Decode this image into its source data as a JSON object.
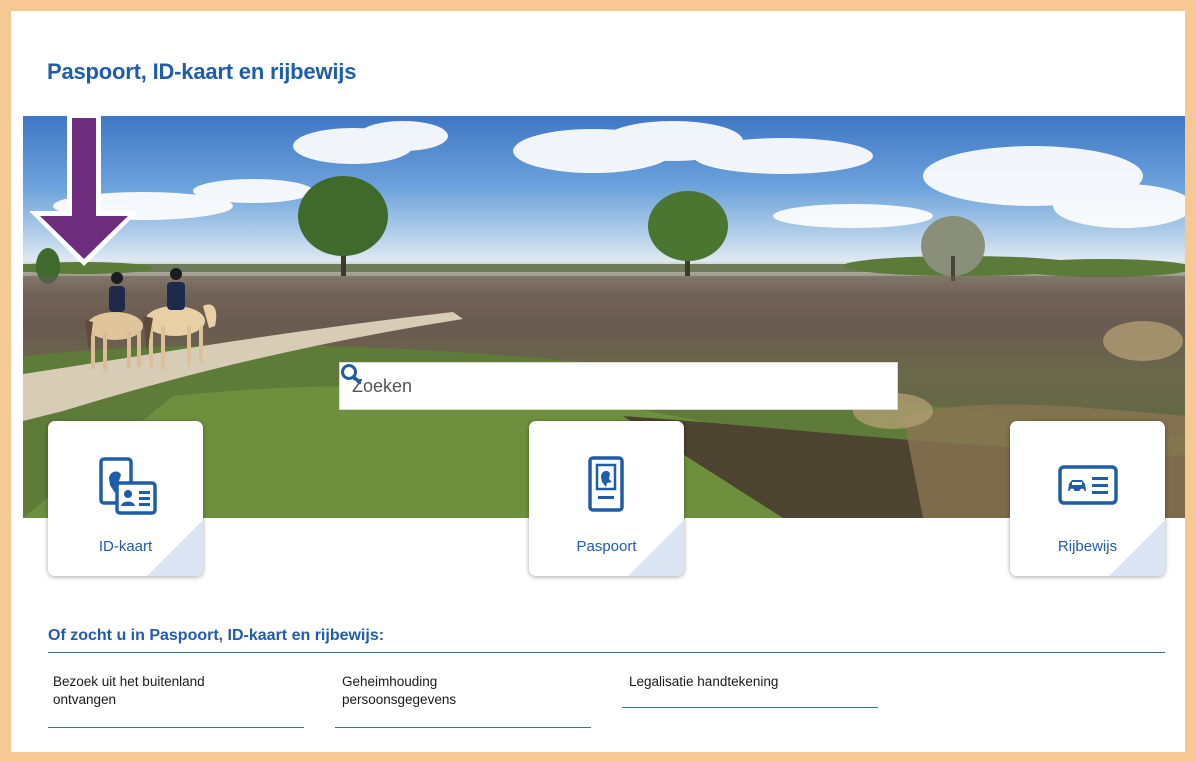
{
  "header": {
    "title": "Paspoort, ID-kaart en rijbewijs"
  },
  "search": {
    "placeholder": "Zoeken",
    "icon": "search-icon"
  },
  "arrow": {
    "color": "#6e2c7d"
  },
  "tiles": [
    {
      "label": "ID-kaart",
      "icon": "id-card-icon"
    },
    {
      "label": "Paspoort",
      "icon": "passport-icon"
    },
    {
      "label": "Rijbewijs",
      "icon": "driving-license-icon"
    }
  ],
  "related": {
    "title": "Of zocht u in Paspoort, ID-kaart en rijbewijs:",
    "links": [
      {
        "line1": "Bezoek uit het buitenland",
        "line2": "ontvangen"
      },
      {
        "line1": "Geheimhouding",
        "line2": "persoonsgegevens"
      },
      {
        "line1": "Legalisatie handtekening",
        "line2": ""
      }
    ]
  },
  "colors": {
    "accent": "#1f5da8",
    "frame": "#f6c994",
    "rule": "#2b7b78"
  }
}
